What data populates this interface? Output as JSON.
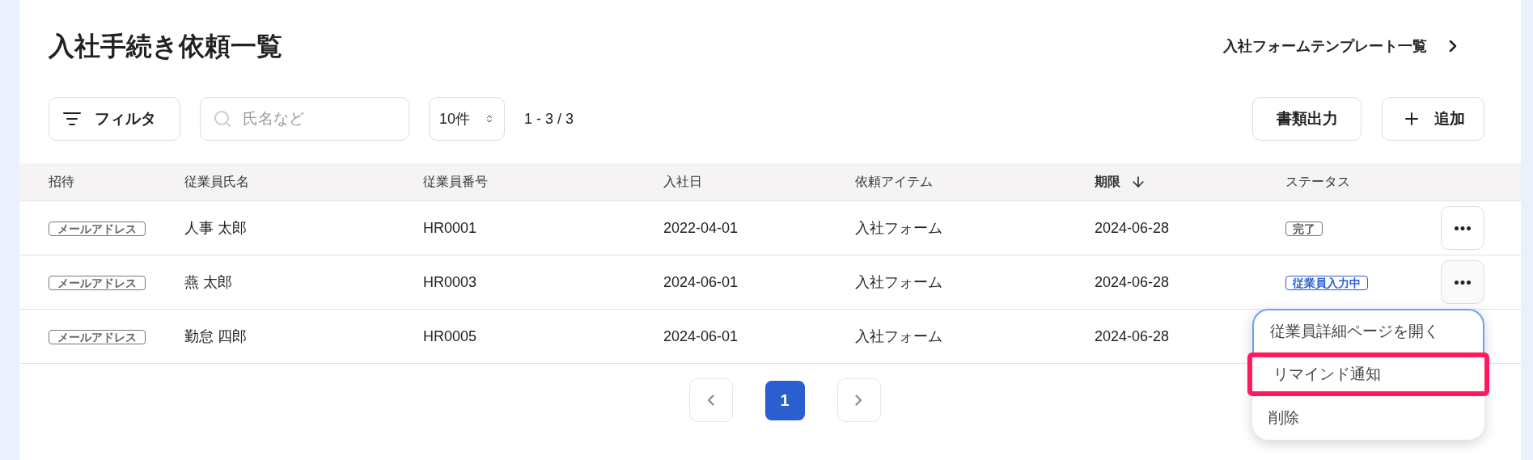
{
  "page": {
    "title": "入社手続き依頼一覧",
    "template_link": "入社フォームテンプレート一覧"
  },
  "toolbar": {
    "filter_button": "フィルタ",
    "search": {
      "placeholder": "氏名など"
    },
    "page_size": "10件",
    "range": "1 - 3 / 3",
    "export_button": "書類出力",
    "add_button": "追加"
  },
  "table": {
    "columns": [
      {
        "label": "招待",
        "sorted": false
      },
      {
        "label": "従業員氏名",
        "sorted": false
      },
      {
        "label": "従業員番号",
        "sorted": false
      },
      {
        "label": "入社日",
        "sorted": false
      },
      {
        "label": "依頼アイテム",
        "sorted": false
      },
      {
        "label": "期限",
        "sorted": true
      },
      {
        "label": "ステータス",
        "sorted": false
      }
    ],
    "rows": [
      {
        "invite": "メールアドレス",
        "name": "人事 太郎",
        "number": "HR0001",
        "hire_date": "2022-04-01",
        "item": "入社フォーム",
        "due": "2024-06-28",
        "status": {
          "label": "完了",
          "kind": "done"
        },
        "menu_button": true,
        "menu_open": false
      },
      {
        "invite": "メールアドレス",
        "name": "燕 太郎",
        "number": "HR0003",
        "hire_date": "2024-06-01",
        "item": "入社フォーム",
        "due": "2024-06-28",
        "status": {
          "label": "従業員入力中",
          "kind": "in_progress"
        },
        "menu_button": true,
        "menu_open": true
      },
      {
        "invite": "メールアドレス",
        "name": "勤怠 四郎",
        "number": "HR0005",
        "hire_date": "2024-06-01",
        "item": "入社フォーム",
        "due": "2024-06-28",
        "menu_button": false,
        "menu_open": false
      }
    ]
  },
  "row_menu": {
    "items": [
      {
        "label": "従業員詳細ページを開く",
        "focused": true,
        "highlighted": false
      },
      {
        "label": "リマインド通知",
        "focused": false,
        "highlighted": true
      },
      {
        "label": "削除",
        "focused": false,
        "highlighted": false
      }
    ]
  },
  "pagination": {
    "pages": [
      {
        "label": "1",
        "selected": true
      }
    ]
  }
}
